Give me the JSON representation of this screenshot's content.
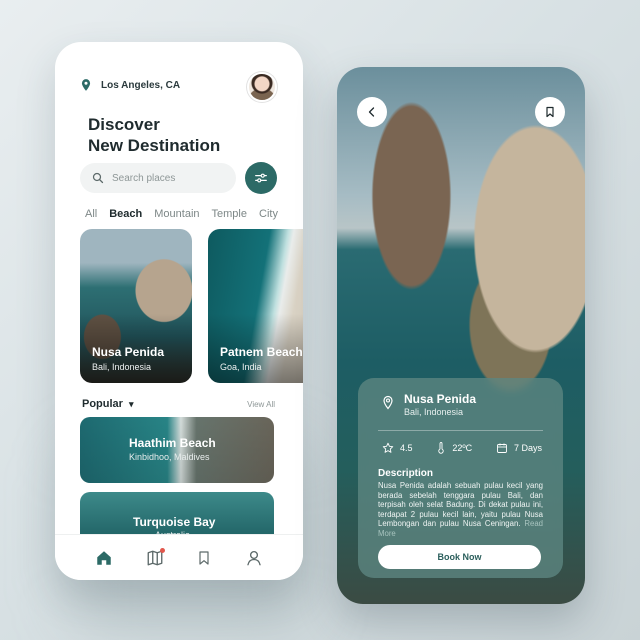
{
  "discover": {
    "location": "Los Angeles, CA",
    "title_line1": "Discover",
    "title_line2": "New Destination",
    "search_placeholder": "Search places",
    "tabs": [
      "All",
      "Beach",
      "Mountain",
      "Temple",
      "City"
    ],
    "active_tab": "Beach",
    "cards": [
      {
        "title": "Nusa Penida",
        "subtitle": "Bali, Indonesia"
      },
      {
        "title": "Patnem Beach",
        "subtitle": "Goa, India"
      }
    ],
    "popular_label": "Popular",
    "popular_chevron": "▾",
    "view_all": "View All",
    "popular_items": [
      {
        "title": "Haathim Beach",
        "subtitle": "Kinbidhoo, Maldives"
      },
      {
        "title": "Turquoise Bay",
        "subtitle": "Australia"
      }
    ],
    "nav_icons": [
      "home-icon",
      "map-icon",
      "bookmark-icon",
      "profile-icon"
    ],
    "accent": "#2c6a66"
  },
  "detail": {
    "title": "Nusa Penida",
    "subtitle": "Bali, Indonesia",
    "rating": "4.5",
    "temperature": "22ºC",
    "duration": "7 Days",
    "description_heading": "Description",
    "description": "Nusa Penida adalah sebuah pulau kecil yang berada sebelah tenggara pulau Bali, dan terpisah oleh selat Badung. Di dekat pulau ini, terdapat 2 pulau kecil lain, yaitu pulau Nusa Lembongan dan pulau Nusa Ceningan.",
    "read_more": "Read More",
    "book_label": "Book Now"
  }
}
